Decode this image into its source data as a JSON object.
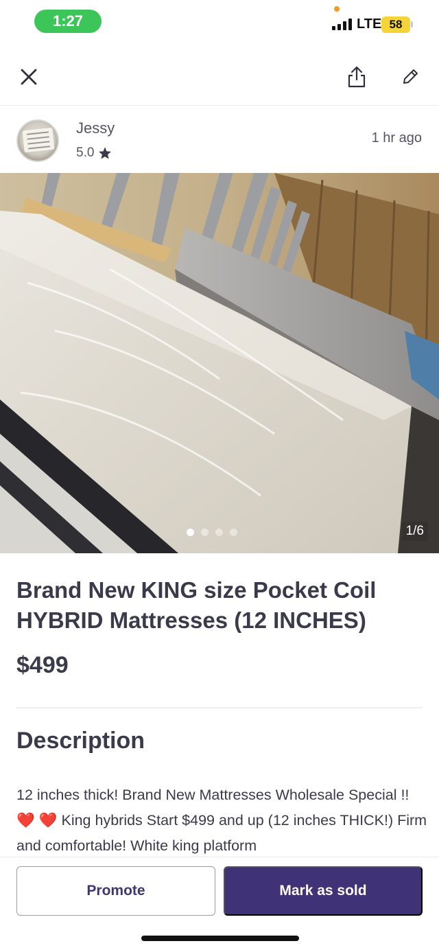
{
  "status_bar": {
    "time": "1:27",
    "network": "LTE",
    "battery": "58",
    "colors": {
      "time_pill": "#3cc65a",
      "battery": "#f5d43a"
    }
  },
  "toolbar": {
    "close_icon": "close-icon",
    "share_icon": "share-icon",
    "edit_icon": "edit-pencil-icon"
  },
  "seller": {
    "name": "Jessy",
    "rating": "5.0",
    "rating_icon": "star-icon",
    "posted": "1 hr ago"
  },
  "gallery": {
    "counter": "1/6",
    "total_images": 6,
    "current_index": 1,
    "visible_dots": 4
  },
  "listing": {
    "title": "Brand New KING size Pocket Coil HYBRID Mattresses (12 INCHES)",
    "price": "$499"
  },
  "description": {
    "heading": "Description",
    "text": "12 inches thick! Brand New Mattresses Wholesale Special !! ❤️ ❤️  King hybrids Start $499 and up (12 inches THICK!) Firm and comfortable! White king platform"
  },
  "actions": {
    "promote_label": "Promote",
    "mark_sold_label": "Mark as sold",
    "accent_color": "#3f3277"
  }
}
